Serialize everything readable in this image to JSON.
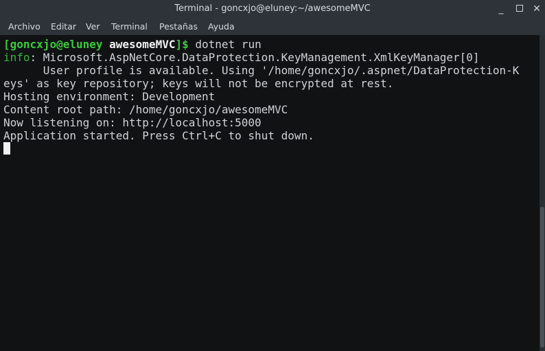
{
  "window": {
    "title": "Terminal - goncxjo@eluney:~/awesomeMVC",
    "controls": {
      "minimize": "_",
      "close": "✕"
    }
  },
  "menubar": {
    "items": [
      "Archivo",
      "Editar",
      "Ver",
      "Terminal",
      "Pestañas",
      "Ayuda"
    ]
  },
  "terminal": {
    "prompt": {
      "open": "[",
      "user_host": "goncxjo@eluney",
      "dir": "awesomeMVC",
      "close": "]$",
      "command": "dotnet run"
    },
    "info_tag": "info",
    "lines": [
      ": Microsoft.AspNetCore.DataProtection.KeyManagement.XmlKeyManager[0]",
      "      User profile is available. Using '/home/goncxjo/.aspnet/DataProtection-K",
      "eys' as key repository; keys will not be encrypted at rest.",
      "Hosting environment: Development",
      "Content root path: /home/goncxjo/awesomeMVC",
      "Now listening on: http://localhost:5000",
      "Application started. Press Ctrl+C to shut down."
    ]
  },
  "colors": {
    "background": "#101214",
    "chrome": "#2d3338",
    "prompt_user": "#3ec93e",
    "info_tag": "#3bb33b",
    "text": "#d0d4d6"
  }
}
